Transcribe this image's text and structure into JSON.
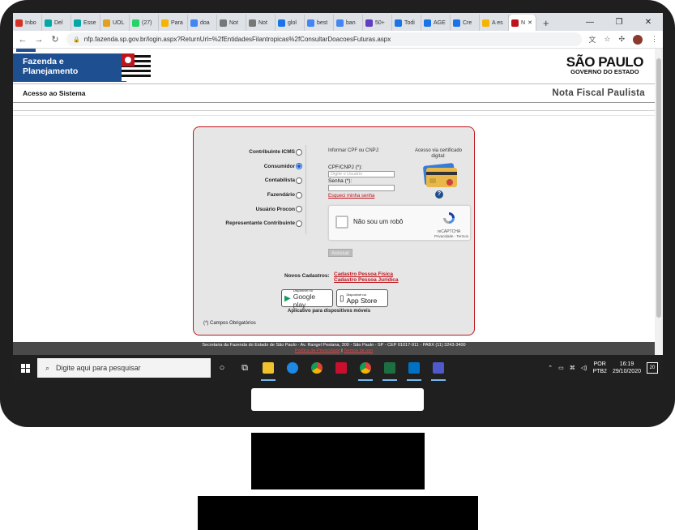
{
  "browser": {
    "tabs": [
      {
        "label": "Inbo",
        "color": "#d93025"
      },
      {
        "label": "Del",
        "color": "#00a8a8"
      },
      {
        "label": "Esse",
        "color": "#00a8a8"
      },
      {
        "label": "UOL",
        "color": "#e0a020"
      },
      {
        "label": "(27)",
        "color": "#25d366"
      },
      {
        "label": "Para",
        "color": "#f4b400"
      },
      {
        "label": "doa",
        "color": "#4285f4"
      },
      {
        "label": "Not",
        "color": "#777777"
      },
      {
        "label": "Not",
        "color": "#777777"
      },
      {
        "label": "glol",
        "color": "#1a73e8"
      },
      {
        "label": "best",
        "color": "#4285f4"
      },
      {
        "label": "ban",
        "color": "#4285f4"
      },
      {
        "label": "50+",
        "color": "#5f3dc4"
      },
      {
        "label": "Todi",
        "color": "#1a73e8"
      },
      {
        "label": "AGE",
        "color": "#1a73e8"
      },
      {
        "label": "Cre",
        "color": "#1a73e8"
      },
      {
        "label": "A es",
        "color": "#f4b400"
      },
      {
        "label": "N",
        "color": "#c0141c"
      }
    ],
    "close_glyph": "✕",
    "new_tab": "+",
    "url": "nfp.fazenda.sp.gov.br/login.aspx?ReturnUrl=%2fEntidadesFilantropicas%2fConsultarDoacoesFuturas.aspx"
  },
  "header": {
    "brand_line1": "Fazenda e",
    "brand_line2": "Planejamento",
    "sp_big": "SÃO PAULO",
    "sp_small": "GOVERNO DO ESTADO",
    "band_left": "Acesso ao Sistema",
    "band_right": "Nota Fiscal Paulista"
  },
  "login": {
    "roles": [
      {
        "label": "Contribuinte ICMS",
        "checked": false
      },
      {
        "label": "Consumidor",
        "checked": true
      },
      {
        "label": "Contabilista",
        "checked": false
      },
      {
        "label": "Fazendário",
        "checked": false
      },
      {
        "label": "Usuário Procon",
        "checked": false
      },
      {
        "label": "Representante Contribuinte",
        "checked": false
      }
    ],
    "inform": "Informar CPF ou CNPJ:",
    "cpf_label": "CPF/CNPJ (*):",
    "cpf_placeholder": "Digite o Usuário",
    "senha_label": "Senha (*):",
    "forgot": "Esqueci minha senha",
    "cert_text": "Acesso via certificado digital:",
    "help": "?",
    "captcha_text": "Não sou um robô",
    "captcha_name": "reCAPTCHA",
    "captcha_terms": "Privacidade - Termos",
    "acessar": "Acessar",
    "novos_label": "Novos Cadastros:",
    "link_fisica": "Cadastro Pessoa Física",
    "link_juridica": "Cadastro Pessoa Jurídica",
    "gp_small": "Disponível no",
    "gp_big": "Google play",
    "as_small": "Disponível na",
    "as_big": "App Store",
    "apps_caption": "Aplicativo para dispositivos móveis",
    "required_note": "(*) Campos Obrigatórios"
  },
  "footer": {
    "address": "Secretaria da Fazenda do Estado de São Paulo - Av. Rangel Pestana, 300 - São Paulo - SP - CEP 01017-911 - PABX (11) 3243-3400",
    "privacy": "Política de Privacidade",
    "divider": "|",
    "terms": "Termos de uso"
  },
  "taskbar": {
    "search_placeholder": "Digite aqui para pesquisar",
    "lang1": "POR",
    "lang2": "PTB2",
    "time": "16:19",
    "date": "29/10/2020",
    "notif_count": "20"
  }
}
